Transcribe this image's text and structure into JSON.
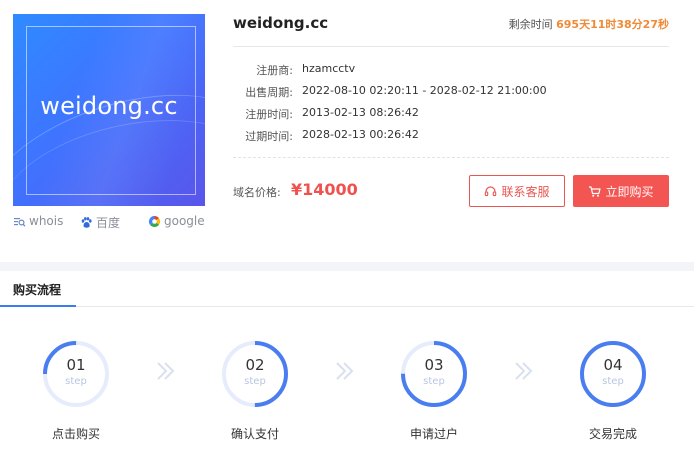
{
  "banner": {
    "text": "weidong.cc"
  },
  "search_links": [
    {
      "label": "whois",
      "icon": "whois-search-icon"
    },
    {
      "label": "百度",
      "icon": "baidu-paw-icon"
    },
    {
      "label": "google",
      "icon": "google-icon"
    }
  ],
  "domain": {
    "name": "weidong.cc"
  },
  "remaining": {
    "label": "剩余时间",
    "value": "695天11时38分27秒"
  },
  "info": [
    {
      "key": "注册商:",
      "value": "hzamcctv"
    },
    {
      "key": "出售周期:",
      "value": "2022-08-10 02:20:11 - 2028-02-12 21:00:00"
    },
    {
      "key": "注册时间:",
      "value": "2013-02-13 08:26:42"
    },
    {
      "key": "过期时间:",
      "value": "2028-02-13 00:26:42"
    }
  ],
  "price": {
    "label": "域名价格:",
    "value": "¥14000"
  },
  "buttons": {
    "service": "联系客服",
    "buy": "立即购买"
  },
  "process": {
    "title": "购买流程",
    "steps": [
      {
        "num": "01",
        "sub": "step",
        "label": "点击购买",
        "progress": 0.25
      },
      {
        "num": "02",
        "sub": "step",
        "label": "确认支付",
        "progress": 0.5
      },
      {
        "num": "03",
        "sub": "step",
        "label": "申请过户",
        "progress": 0.75
      },
      {
        "num": "04",
        "sub": "step",
        "label": "交易完成",
        "progress": 1.0
      }
    ]
  },
  "colors": {
    "accent_red": "#f35552",
    "accent_blue": "#3d7cf0",
    "countdown_orange": "#f08a36",
    "ring_track": "#e6ecfb",
    "ring_progress": "#4a7ef0"
  }
}
